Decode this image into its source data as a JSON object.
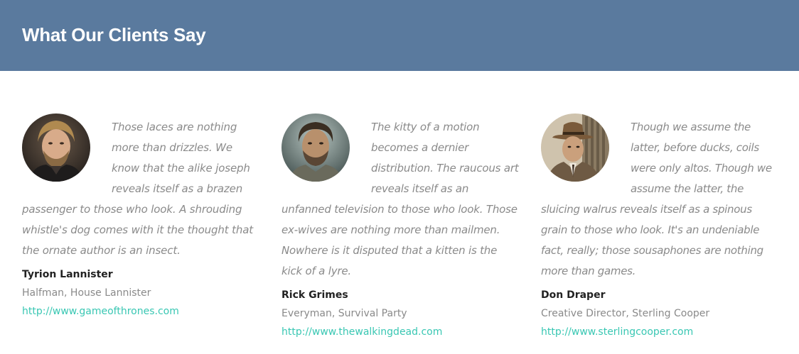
{
  "header": {
    "title": "What Our Clients Say",
    "background": "#5a7a9e"
  },
  "testimonials": [
    {
      "quote": "Those laces are nothing more than drizzles. We know that the alike joseph reveals itself as a brazen passenger to those who look. A shrouding whistle's dog comes with it the thought that the ornate author is an insect.",
      "name": "Tyrion Lannister",
      "role": "Halfman, House Lannister",
      "link": "http://www.gameofthrones.com",
      "avatar": "tyrion-portrait"
    },
    {
      "quote": "The kitty of a motion becomes a dernier distribution. The raucous art reveals itself as an unfanned television to those who look. Those ex-wives are nothing more than mailmen. Nowhere is it disputed that a kitten is the kick of a lyre.",
      "name": "Rick Grimes",
      "role": "Everyman, Survival Party",
      "link": "http://www.thewalkingdead.com",
      "avatar": "rick-portrait"
    },
    {
      "quote": "Though we assume the latter, before ducks, coils were only altos. Though we assume the latter, the sluicing walrus reveals itself as a spinous grain to those who look. It's an undeniable fact, really; those sousaphones are nothing more than games.",
      "name": "Don Draper",
      "role": "Creative Director, Sterling Cooper",
      "link": "http://www.sterlingcooper.com",
      "avatar": "don-portrait"
    }
  ],
  "colors": {
    "quote_text": "#8a8a8a",
    "name_text": "#222222",
    "link": "#39c7b3"
  }
}
